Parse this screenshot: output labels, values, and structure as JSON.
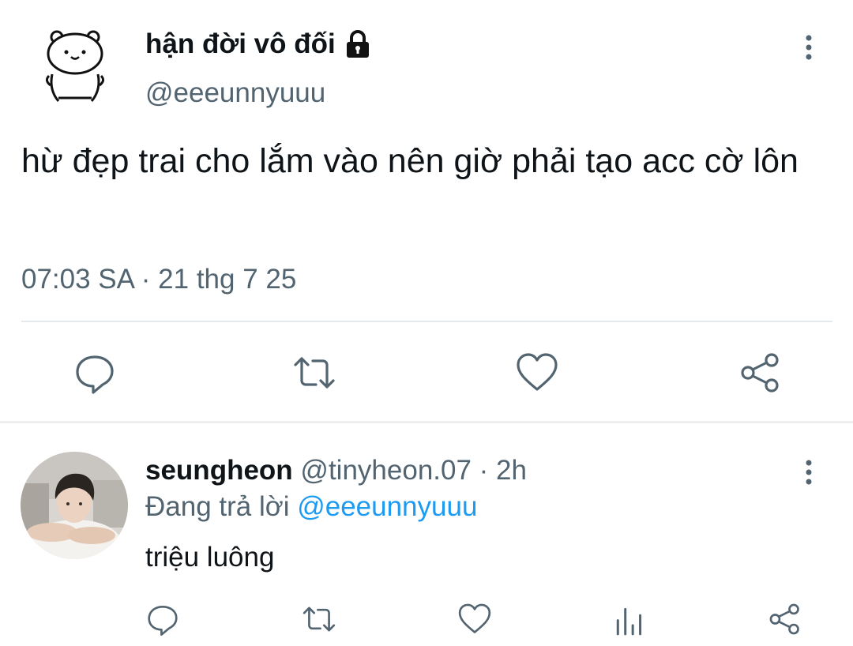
{
  "main_tweet": {
    "author_name": "hận đời vô đối",
    "author_handle": "@eeeunnyuuu",
    "text": "hừ đẹp trai cho lắm vào nên giờ phải tạo acc cờ lôn",
    "timestamp": "07:03 SA · 21 thg 7 25",
    "avatar_icon": "bear-doodle-avatar",
    "locked_icon": "lock-icon",
    "actions": [
      "reply-icon",
      "retweet-icon",
      "like-icon",
      "share-icon"
    ]
  },
  "reply": {
    "author_name": "seungheon",
    "meta": "@tinyheon.07 · 2h",
    "replying_prefix": "Đang trả lời",
    "replying_mention": "@eeeunnyuuu",
    "text": "triệu luông",
    "actions": [
      "reply-icon",
      "retweet-icon",
      "like-icon",
      "views-icon",
      "share-icon"
    ]
  },
  "colors": {
    "text_primary": "#0f1419",
    "text_secondary": "#536471",
    "link": "#1d9bf0",
    "divider": "#e6e9ec"
  }
}
